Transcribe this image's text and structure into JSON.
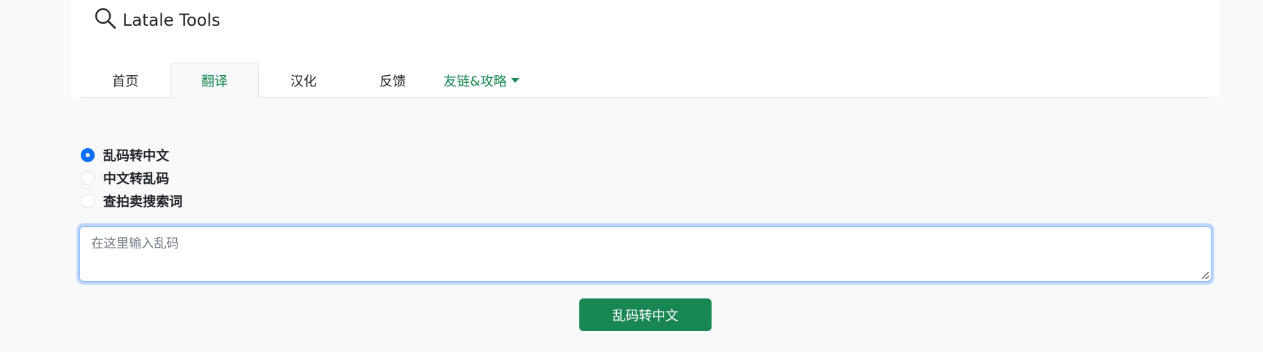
{
  "brand": {
    "title": "Latale Tools",
    "icon": "search-icon"
  },
  "nav": {
    "tabs": [
      {
        "label": "首页",
        "active": false
      },
      {
        "label": "翻译",
        "active": true
      },
      {
        "label": "汉化",
        "active": false
      },
      {
        "label": "反馈",
        "active": false
      }
    ],
    "dropdown": {
      "label": "友链&攻略",
      "icon": "caret-down-icon"
    }
  },
  "modes": {
    "options": [
      {
        "label": "乱码转中文",
        "checked": true
      },
      {
        "label": "中文转乱码",
        "checked": false
      },
      {
        "label": "查拍卖搜索词",
        "checked": false
      }
    ]
  },
  "input": {
    "placeholder": "在这里输入乱码",
    "value": ""
  },
  "submit": {
    "label": "乱码转中文"
  },
  "colors": {
    "accent": "#198754",
    "radio_checked": "#0d6efd",
    "page_bg": "#f8f9fa"
  }
}
